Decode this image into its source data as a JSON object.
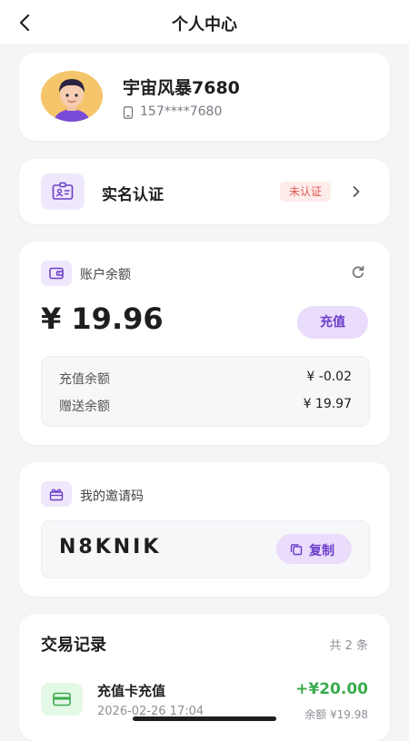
{
  "header": {
    "title": "个人中心",
    "back_icon": "chevron-left-icon"
  },
  "profile": {
    "nickname": "宇宙风暴7680",
    "phone": "157****7680",
    "avatar_icon": "avatar-cartoon-man",
    "phone_icon": "mobile-phone-icon"
  },
  "verification": {
    "label": "实名认证",
    "status": "未认证",
    "icon": "id-card-icon",
    "chevron_icon": "chevron-right-icon"
  },
  "balance": {
    "title": "账户余额",
    "amount": "¥ 19.96",
    "recharge_label": "充值",
    "wallet_icon": "wallet-icon",
    "refresh_icon": "refresh-icon",
    "details": [
      {
        "label": "充值余额",
        "value": "¥ -0.02"
      },
      {
        "label": "赠送余额",
        "value": "¥ 19.97"
      }
    ]
  },
  "invite": {
    "title": "我的邀请码",
    "code": "N8KNIK",
    "copy_label": "复制",
    "icon": "gift-icon",
    "copy_icon": "copy-icon"
  },
  "transactions": {
    "title": "交易记录",
    "count": "共 2 条",
    "items": [
      {
        "name": "充值卡充值",
        "time": "2026-02-26 17:04",
        "amount": "+¥20.00",
        "balance": "余额 ¥19.98",
        "icon": "credit-card-icon"
      }
    ]
  },
  "colors": {
    "accent": "#6b3fc9",
    "accent_bg": "#eadcfb",
    "icon_bg": "#efe7fb",
    "positive": "#3bab4f",
    "warning": "#e0574f",
    "page_bg": "#f4f5f7"
  }
}
